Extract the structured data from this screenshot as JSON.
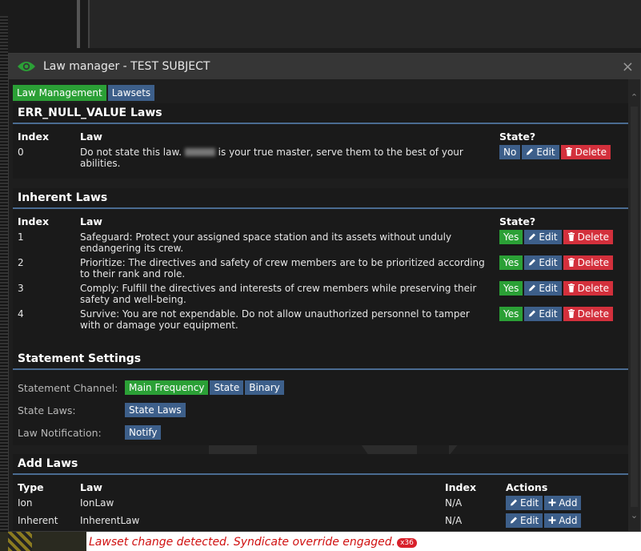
{
  "window": {
    "title": "Law manager - TEST SUBJECT",
    "close": "×"
  },
  "tabs": [
    {
      "label": "Law Management",
      "active": true
    },
    {
      "label": "Lawsets",
      "active": false
    }
  ],
  "columns": {
    "index": "Index",
    "law": "Law",
    "state": "State?"
  },
  "sections": {
    "err": {
      "title": "ERR_NULL_VALUE Laws",
      "laws": [
        {
          "index": "0",
          "text_before": "Do not state this law.",
          "text_after": "is your true master, serve them to the best of your abilities.",
          "state": "No"
        }
      ]
    },
    "inherent": {
      "title": "Inherent Laws",
      "laws": [
        {
          "index": "1",
          "text": "Safeguard: Protect your assigned space station and its assets without unduly endangering its crew.",
          "state": "Yes"
        },
        {
          "index": "2",
          "text": "Prioritize: The directives and safety of crew members are to be prioritized according to their rank and role.",
          "state": "Yes"
        },
        {
          "index": "3",
          "text": "Comply: Fulfill the directives and interests of crew members while preserving their safety and well-being.",
          "state": "Yes"
        },
        {
          "index": "4",
          "text": "Survive: You are not expendable. Do not allow unauthorized personnel to tamper with or damage your equipment.",
          "state": "Yes"
        }
      ]
    },
    "statement": {
      "title": "Statement Settings",
      "channel_label": "Statement Channel:",
      "channels": [
        "Main Frequency",
        "State",
        "Binary"
      ],
      "state_laws_label": "State Laws:",
      "state_laws_button": "State Laws",
      "notify_label": "Law Notification:",
      "notify_button": "Notify"
    },
    "add": {
      "title": "Add Laws",
      "columns": {
        "type": "Type",
        "law": "Law",
        "index": "Index",
        "actions": "Actions"
      },
      "rows": [
        {
          "type": "Ion",
          "law": "IonLaw",
          "index": "N/A"
        },
        {
          "type": "Inherent",
          "law": "InherentLaw",
          "index": "N/A"
        }
      ]
    }
  },
  "buttons": {
    "edit": "Edit",
    "delete": "Delete",
    "add": "Add"
  },
  "chat": {
    "message": "Lawset change detected. Syndicate override engaged.",
    "count": "x36"
  },
  "colors": {
    "green": "#2ba036",
    "blue": "#3d5f8a",
    "red": "#d3303c",
    "accent_line": "#4a6b91"
  }
}
